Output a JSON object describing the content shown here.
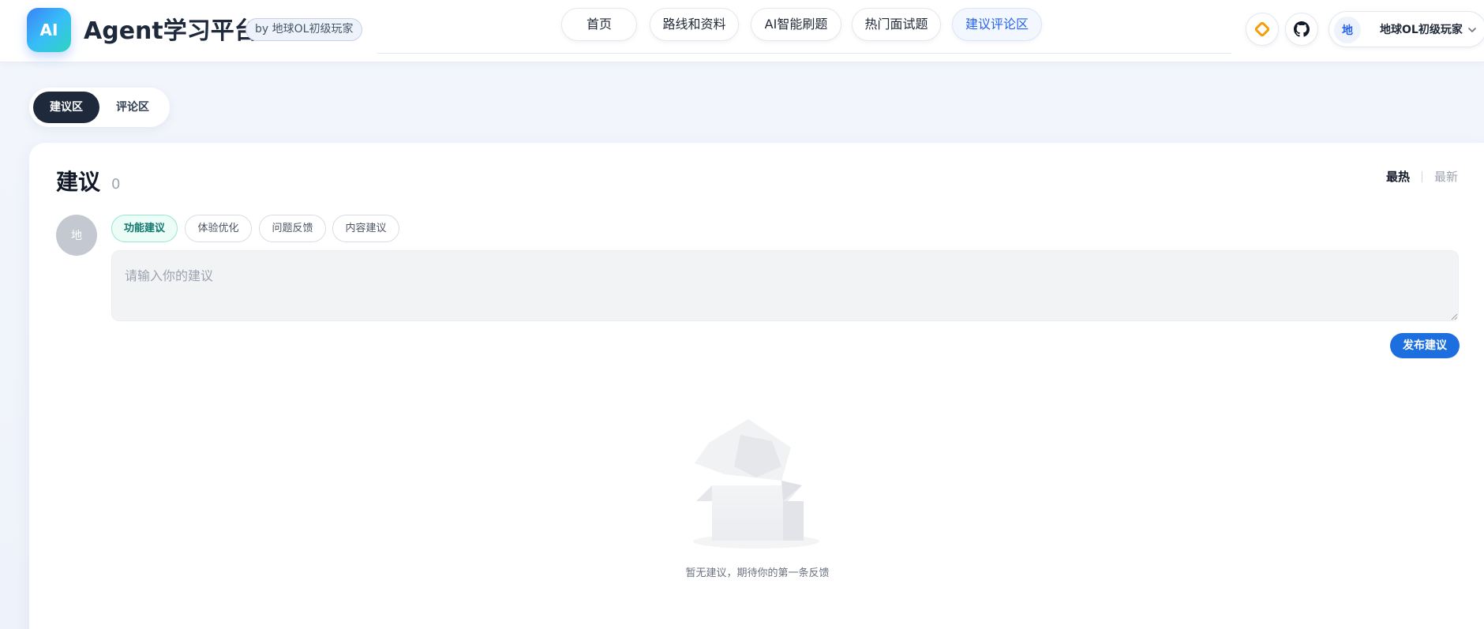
{
  "header": {
    "logo_text": "AI",
    "site_title": "Agent学习平台",
    "author_badge": "by 地球OL初级玩家",
    "nav": [
      {
        "label": "首页",
        "active": false
      },
      {
        "label": "路线和资料",
        "active": false
      },
      {
        "label": "AI智能刷题",
        "active": false
      },
      {
        "label": "热门面试题",
        "active": false
      },
      {
        "label": "建议评论区",
        "active": true
      }
    ],
    "icons": [
      "diamond-icon",
      "github-icon"
    ],
    "user": {
      "avatar_text": "地",
      "name": "地球OL初级玩家"
    }
  },
  "segments": [
    {
      "label": "建议区",
      "active": true
    },
    {
      "label": "评论区",
      "active": false
    }
  ],
  "card": {
    "title": "建议",
    "count": "0",
    "sort": [
      {
        "label": "最热",
        "active": true
      },
      {
        "label": "最新",
        "active": false
      }
    ],
    "avatar_text": "地",
    "chips": [
      {
        "label": "功能建议",
        "active": true
      },
      {
        "label": "体验优化",
        "active": false
      },
      {
        "label": "问题反馈",
        "active": false
      },
      {
        "label": "内容建议",
        "active": false
      }
    ],
    "input": {
      "placeholder": "请输入你的建议",
      "value": ""
    },
    "publish_label": "发布建议",
    "empty_text": "暂无建议，期待你的第一条反馈"
  },
  "colors": {
    "accent": "#1d6fe0",
    "nav_active": "#2563eb",
    "segment_active_bg": "#1e293b",
    "chip_active_bg": "#ecfdf8",
    "chip_active_text": "#0f766e"
  }
}
